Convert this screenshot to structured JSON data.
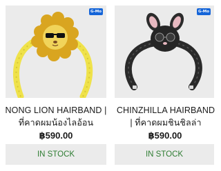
{
  "products": [
    {
      "title": "NONG LION HAIRBAND | ที่คาดผมน้องไลอ้อน",
      "price": "฿590.00",
      "status": "IN STOCK",
      "badge": "G-Mo",
      "image_icon": "lion-hairband-image"
    },
    {
      "title": "CHINZHILLA HAIRBAND | ที่คาดผมชินชิลล่า",
      "price": "฿590.00",
      "status": "IN STOCK",
      "badge": "G-Mo",
      "image_icon": "chinchilla-hairband-image"
    }
  ],
  "colors": {
    "photo_bg": "#ebebeb",
    "stock_text": "#2e7d32",
    "badge_bg": "#1565d8"
  }
}
